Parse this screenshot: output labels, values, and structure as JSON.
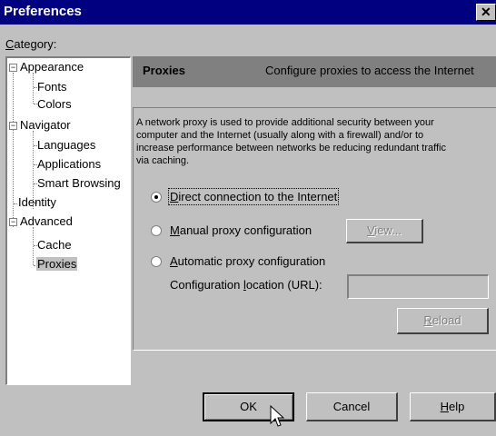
{
  "window": {
    "title": "Preferences",
    "close_glyph": "✕"
  },
  "category_label_u": "C",
  "category_label_rest": "ategory:",
  "tree": {
    "appearance": "Appearance",
    "fonts": "Fonts",
    "colors": "Colors",
    "navigator": "Navigator",
    "languages": "Languages",
    "applications": "Applications",
    "smart_browsing": "Smart Browsing",
    "identity": "Identity",
    "advanced": "Advanced",
    "cache": "Cache",
    "proxies": "Proxies",
    "expand_glyph": "−"
  },
  "header": {
    "title": "Proxies",
    "description": "Configure proxies to access the Internet"
  },
  "description_lines": [
    "A network proxy is used to provide additional security between your",
    "computer and the Internet (usually along with a firewall) and/or to",
    "increase performance between networks be reducing redundant traffic",
    "via caching."
  ],
  "options": {
    "direct_u": "D",
    "direct_rest": "irect connection to the Internet",
    "manual_u": "M",
    "manual_rest": "anual proxy configuration",
    "auto_u": "A",
    "auto_rest": "utomatic proxy configuration",
    "selected": "direct"
  },
  "view_button_u": "V",
  "view_button_rest": "iew...",
  "config_location_pre": "Configuration ",
  "config_location_u": "l",
  "config_location_post": "ocation (URL):",
  "config_location_value": "",
  "reload_button_u": "R",
  "reload_button_rest": "eload",
  "buttons": {
    "ok": "OK",
    "cancel": "Cancel",
    "help_u": "H",
    "help_rest": "elp"
  }
}
